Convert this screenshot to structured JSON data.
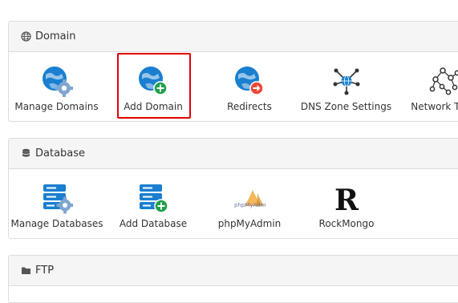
{
  "domain": {
    "title": "Domain",
    "items": [
      {
        "label": "Manage Domains"
      },
      {
        "label": "Add Domain"
      },
      {
        "label": "Redirects"
      },
      {
        "label": "DNS Zone Settings"
      },
      {
        "label": "Network Tools"
      }
    ]
  },
  "database": {
    "title": "Database",
    "items": [
      {
        "label": "Manage Databases"
      },
      {
        "label": "Add Database"
      },
      {
        "label": "phpMyAdmin"
      },
      {
        "label": "RockMongo"
      }
    ],
    "phpmyadmin_logo_text": "phpMyAdmin",
    "rockmongo_logo_text": "R"
  },
  "ftp": {
    "title": "FTP"
  },
  "colors": {
    "globe_blue": "#1a7fd0",
    "gear_blue": "#7fa6cf",
    "add_green": "#1ea04a",
    "redirect_red": "#e8483a",
    "highlight_red": "#e00000"
  }
}
